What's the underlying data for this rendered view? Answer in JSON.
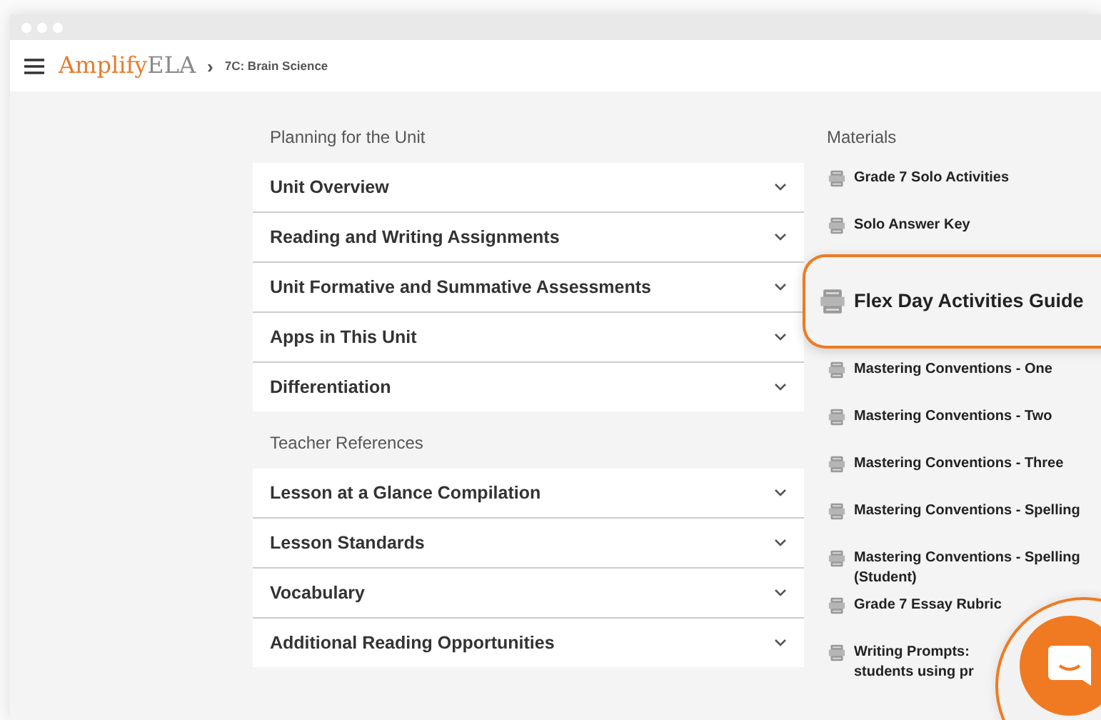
{
  "header": {
    "logo_brand": "Amplify",
    "logo_product": "ELA",
    "breadcrumb_separator": "›",
    "breadcrumb": "7C: Brain Science"
  },
  "sections": [
    {
      "title": "Planning for the Unit",
      "items": [
        {
          "label": "Unit Overview",
          "expanded": false
        },
        {
          "label": "Reading and Writing Assignments",
          "expanded": false
        },
        {
          "label": "Unit Formative and Summative Assessments",
          "expanded": false
        },
        {
          "label": "Apps in This Unit",
          "expanded": false
        },
        {
          "label": "Differentiation",
          "expanded": false
        }
      ]
    },
    {
      "title": "Teacher References",
      "items": [
        {
          "label": "Lesson at a Glance Compilation",
          "expanded": false
        },
        {
          "label": "Lesson Standards",
          "expanded": false
        },
        {
          "label": "Vocabulary",
          "expanded": false
        },
        {
          "label": "Additional Reading Opportunities",
          "expanded": false
        }
      ]
    }
  ],
  "materials": {
    "title": "Materials",
    "items": [
      {
        "label": "Grade 7 Solo Activities",
        "kind": "file"
      },
      {
        "label": "Solo Answer Key",
        "kind": "file"
      },
      {
        "label": "Flex Day Activities Guide",
        "kind": "callout"
      },
      {
        "label": "Mastering Conventions - One",
        "kind": "file"
      },
      {
        "label": "Mastering Conventions - Two",
        "kind": "file"
      },
      {
        "label": "Mastering Conventions - Three",
        "kind": "file"
      },
      {
        "label": "Mastering Conventions - Spelling",
        "kind": "file"
      },
      {
        "label": "Mastering Conventions - Spelling (Student)",
        "kind": "file"
      },
      {
        "label": "Grade 7 Essay Rubric",
        "kind": "file"
      },
      {
        "label": "Writing Prompts: students using pr",
        "kind": "covered"
      }
    ]
  }
}
